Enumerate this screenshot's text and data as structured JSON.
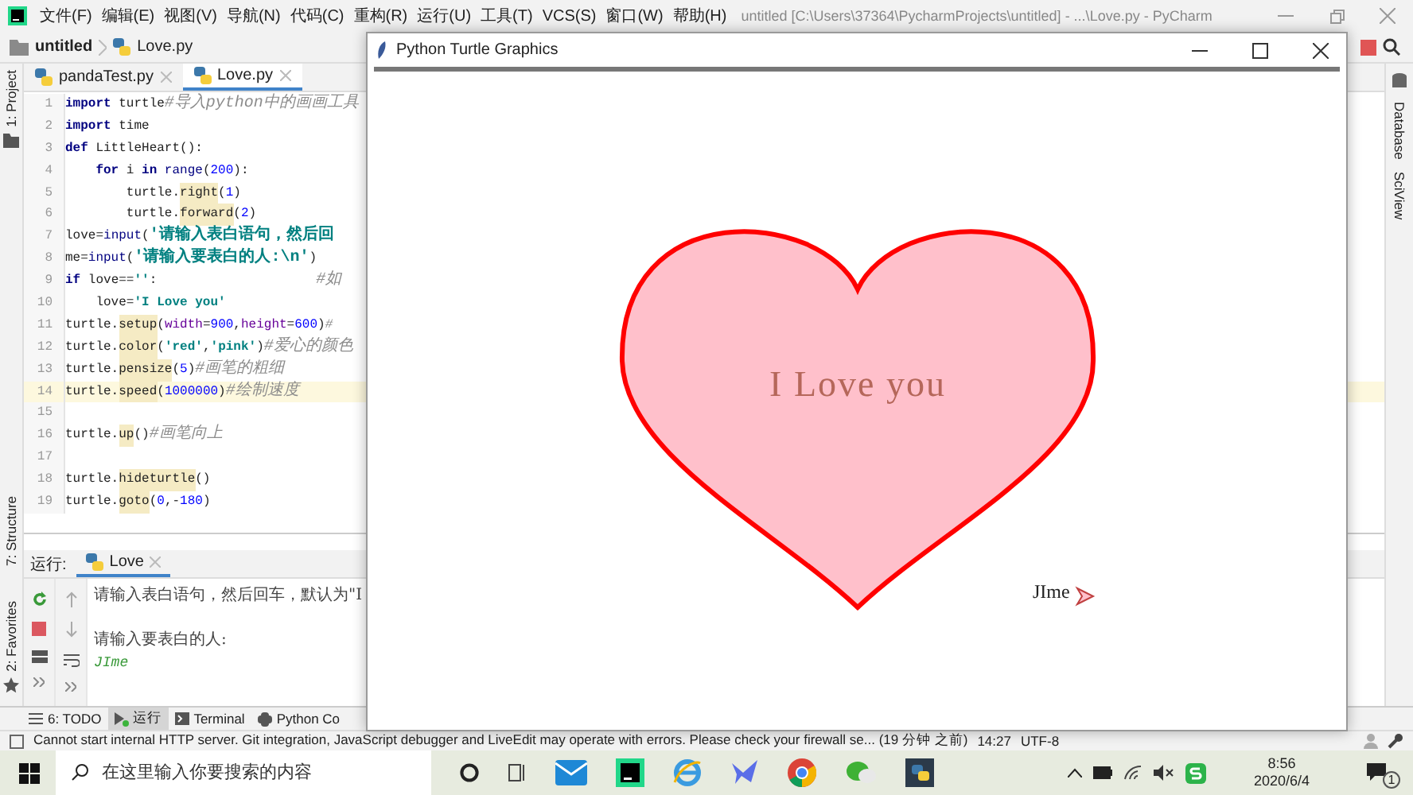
{
  "window": {
    "title": "untitled [C:\\Users\\37364\\PycharmProjects\\untitled] - ...\\Love.py - PyCharm"
  },
  "menu": [
    "文件(F)",
    "编辑(E)",
    "视图(V)",
    "导航(N)",
    "代码(C)",
    "重构(R)",
    "运行(U)",
    "工具(T)",
    "VCS(S)",
    "窗口(W)",
    "帮助(H)"
  ],
  "breadcrumbs": [
    "untitled",
    "Love.py"
  ],
  "left_tool_strip": [
    "1: Project",
    "7: Structure",
    "2: Favorites"
  ],
  "right_tool_strip": [
    "Database",
    "SciView"
  ],
  "editor": {
    "tabs": [
      {
        "label": "pandaTest.py",
        "selected": false
      },
      {
        "label": "Love.py",
        "selected": true
      }
    ],
    "lines": [
      {
        "number": "1",
        "current": false,
        "tokens": [
          {
            "text": "import",
            "kind": "kw"
          },
          {
            "text": " turtle",
            "kind": "plain"
          },
          {
            "text": "#导入python中的画画工具",
            "kind": "comment"
          }
        ]
      },
      {
        "number": "2",
        "current": false,
        "tokens": [
          {
            "text": "import",
            "kind": "kw"
          },
          {
            "text": " time",
            "kind": "plain"
          }
        ]
      },
      {
        "number": "3",
        "current": false,
        "tokens": [
          {
            "text": "def",
            "kind": "kw"
          },
          {
            "text": " LittleHeart():",
            "kind": "plain"
          }
        ]
      },
      {
        "number": "4",
        "current": false,
        "tokens": [
          {
            "text": "    for",
            "kind": "kw"
          },
          {
            "text": " i ",
            "kind": "plain"
          },
          {
            "text": "in",
            "kind": "kw"
          },
          {
            "text": " range",
            "kind": "builtin"
          },
          {
            "text": "(",
            "kind": "plain"
          },
          {
            "text": "200",
            "kind": "num"
          },
          {
            "text": "):",
            "kind": "plain"
          }
        ]
      },
      {
        "number": "5",
        "current": false,
        "tokens": [
          {
            "text": "        turtle.",
            "kind": "plain"
          },
          {
            "text": "right",
            "kind": "fn"
          },
          {
            "text": "(",
            "kind": "plain"
          },
          {
            "text": "1",
            "kind": "num"
          },
          {
            "text": ")",
            "kind": "plain"
          }
        ]
      },
      {
        "number": "6",
        "current": false,
        "tokens": [
          {
            "text": "        turtle.",
            "kind": "plain"
          },
          {
            "text": "forward",
            "kind": "fn"
          },
          {
            "text": "(",
            "kind": "plain"
          },
          {
            "text": "2",
            "kind": "num"
          },
          {
            "text": ")",
            "kind": "plain"
          }
        ]
      },
      {
        "number": "7",
        "current": false,
        "tokens": [
          {
            "text": "love=",
            "kind": "plain"
          },
          {
            "text": "input",
            "kind": "builtin"
          },
          {
            "text": "(",
            "kind": "plain"
          },
          {
            "text": "'请输入表白语句，然后回",
            "kind": "str"
          }
        ]
      },
      {
        "number": "8",
        "current": false,
        "tokens": [
          {
            "text": "me=",
            "kind": "plain"
          },
          {
            "text": "input",
            "kind": "builtin"
          },
          {
            "text": "(",
            "kind": "plain"
          },
          {
            "text": "'请输入要表白的人:\\n'",
            "kind": "str"
          },
          {
            "text": ")",
            "kind": "plain"
          }
        ]
      },
      {
        "number": "9",
        "current": false,
        "tokens": [
          {
            "text": "if",
            "kind": "kw"
          },
          {
            "text": " love==",
            "kind": "plain"
          },
          {
            "text": "''",
            "kind": "str"
          },
          {
            "text": ":",
            "kind": "plain"
          },
          {
            "text": "#如",
            "kind": "far-comment"
          }
        ]
      },
      {
        "number": "10",
        "current": false,
        "tokens": [
          {
            "text": "    love=",
            "kind": "plain"
          },
          {
            "text": "'I Love you'",
            "kind": "str"
          }
        ]
      },
      {
        "number": "11",
        "current": false,
        "tokens": [
          {
            "text": "turtle.",
            "kind": "plain"
          },
          {
            "text": "setup",
            "kind": "fn"
          },
          {
            "text": "(",
            "kind": "plain"
          },
          {
            "text": "width",
            "kind": "param"
          },
          {
            "text": "=",
            "kind": "plain"
          },
          {
            "text": "900",
            "kind": "num"
          },
          {
            "text": ",",
            "kind": "plain"
          },
          {
            "text": "height",
            "kind": "param"
          },
          {
            "text": "=",
            "kind": "plain"
          },
          {
            "text": "600",
            "kind": "num"
          },
          {
            "text": ")",
            "kind": "plain"
          },
          {
            "text": "#",
            "kind": "comment"
          }
        ]
      },
      {
        "number": "12",
        "current": false,
        "tokens": [
          {
            "text": "turtle.",
            "kind": "plain"
          },
          {
            "text": "color",
            "kind": "fn"
          },
          {
            "text": "(",
            "kind": "plain"
          },
          {
            "text": "'red'",
            "kind": "str"
          },
          {
            "text": ",",
            "kind": "plain"
          },
          {
            "text": "'pink'",
            "kind": "str"
          },
          {
            "text": ")",
            "kind": "plain"
          },
          {
            "text": "#爱心的颜色",
            "kind": "comment"
          }
        ]
      },
      {
        "number": "13",
        "current": false,
        "tokens": [
          {
            "text": "turtle.",
            "kind": "plain"
          },
          {
            "text": "pensize",
            "kind": "fn"
          },
          {
            "text": "(",
            "kind": "plain"
          },
          {
            "text": "5",
            "kind": "num"
          },
          {
            "text": ")",
            "kind": "plain"
          },
          {
            "text": "#画笔的粗细",
            "kind": "comment"
          }
        ]
      },
      {
        "number": "14",
        "current": true,
        "tokens": [
          {
            "text": "turtle.",
            "kind": "plain"
          },
          {
            "text": "speed",
            "kind": "fn"
          },
          {
            "text": "(",
            "kind": "plain"
          },
          {
            "text": "1000000",
            "kind": "num"
          },
          {
            "text": ")",
            "kind": "plain"
          },
          {
            "text": "#绘制速度",
            "kind": "comment"
          }
        ]
      },
      {
        "number": "15",
        "current": false
      },
      {
        "number": "16",
        "current": false,
        "tokens": [
          {
            "text": "turtle.",
            "kind": "plain"
          },
          {
            "text": "up",
            "kind": "fn"
          },
          {
            "text": "()",
            "kind": "plain"
          },
          {
            "text": "#画笔向上",
            "kind": "comment"
          }
        ]
      },
      {
        "number": "17",
        "current": false
      },
      {
        "number": "18",
        "current": false,
        "tokens": [
          {
            "text": "turtle.",
            "kind": "plain"
          },
          {
            "text": "hideturtle",
            "kind": "fn"
          },
          {
            "text": "()",
            "kind": "plain"
          }
        ]
      },
      {
        "number": "19",
        "current": false,
        "tokens": [
          {
            "text": "turtle.",
            "kind": "plain"
          },
          {
            "text": "goto",
            "kind": "fn"
          },
          {
            "text": "(",
            "kind": "plain"
          },
          {
            "text": "0",
            "kind": "num"
          },
          {
            "text": ",-",
            "kind": "plain"
          },
          {
            "text": "180",
            "kind": "num"
          },
          {
            "text": ")",
            "kind": "plain"
          }
        ]
      }
    ]
  },
  "run_panel": {
    "label": "运行:",
    "tab": "Love",
    "output": [
      {
        "text": "请输入表白语句，然后回车，默认为\"I",
        "kind": "prompt"
      },
      {
        "text": "请输入要表白的人:",
        "kind": "prompt"
      },
      {
        "text": "JIme",
        "kind": "input"
      }
    ]
  },
  "tool_tabs": [
    {
      "label": "6: TODO",
      "kind": "todo",
      "selected": false
    },
    {
      "label": "运行",
      "kind": "run",
      "selected": true
    },
    {
      "label": "Terminal",
      "kind": "terminal",
      "selected": false
    },
    {
      "label": "Python Co",
      "kind": "console",
      "selected": false
    }
  ],
  "status_bar": {
    "message": "Cannot start internal HTTP server. Git integration, JavaScript debugger and LiveEdit may operate with errors. Please check your firewall se... (19 分钟 之前)",
    "position": "14:27",
    "encoding": "UTF-8"
  },
  "turtle_window": {
    "title": "Python Turtle Graphics",
    "heart_text": "I Love you",
    "signature": "JIme"
  },
  "taskbar": {
    "search_placeholder": "在这里输入你要搜索的内容",
    "time": "8:56",
    "date": "2020/6/4",
    "notifications": "1"
  }
}
